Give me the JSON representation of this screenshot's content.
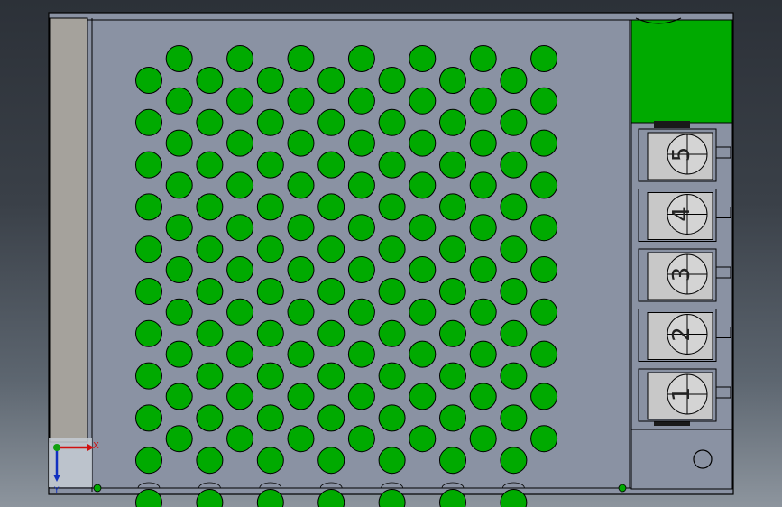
{
  "viewport": {
    "view": "top",
    "colors": {
      "background_top": "#2c3138",
      "background_bottom": "#8d959e",
      "housing": "#8a92a3",
      "side_rail": "#a5a29c",
      "vent_hole": "#00aa00",
      "pcb": "#00aa00",
      "terminal_block": "#c8c8c8",
      "terminal_divider": "#3a3a3a",
      "edge": "#000000"
    },
    "vent_grid": {
      "columns": 14,
      "rows_even": 11,
      "rows_odd": 10,
      "shape": "circle"
    },
    "terminal_block": {
      "terminals": [
        {
          "label": "5"
        },
        {
          "label": "4"
        },
        {
          "label": "3"
        },
        {
          "label": "2"
        },
        {
          "label": "1"
        }
      ]
    },
    "triad": {
      "x_label": "X",
      "y_label": "Y",
      "x_color": "#d01010",
      "y_color": "#1030c0",
      "origin_color": "#10a010"
    }
  }
}
